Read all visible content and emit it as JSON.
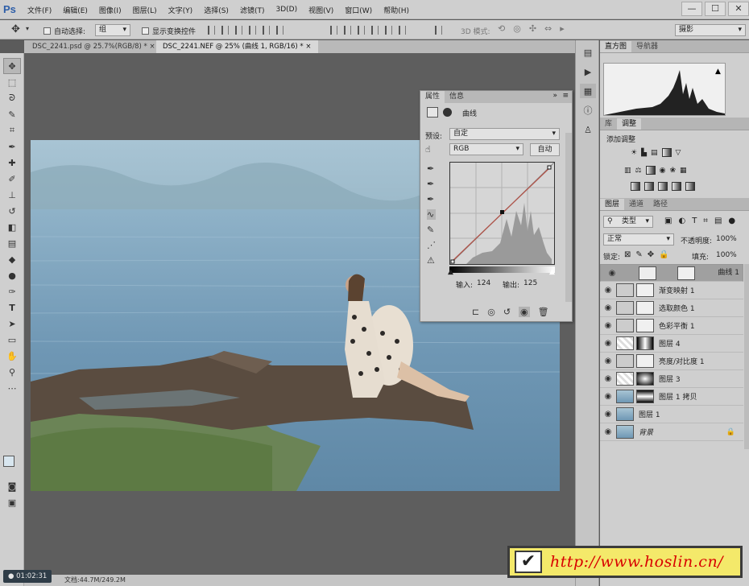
{
  "app": {
    "logo": "Ps"
  },
  "menu": [
    "文件(F)",
    "编辑(E)",
    "图像(I)",
    "图层(L)",
    "文字(Y)",
    "选择(S)",
    "滤镜(T)",
    "3D(D)",
    "视图(V)",
    "窗口(W)",
    "帮助(H)"
  ],
  "window_buttons": [
    "—",
    "☐",
    "✕"
  ],
  "options": {
    "auto_select_label": "自动选择:",
    "auto_select_value": "组",
    "show_transform_label": "显示变换控件",
    "mode3d_label": "3D 模式:",
    "workspace": "摄影"
  },
  "doc_tabs": [
    "DSC_2241.psd @ 25.7%(RGB/8) *",
    "DSC_2241.NEF @ 25% (曲线 1, RGB/16) *"
  ],
  "status": {
    "timer": "01:02:31",
    "doc_size": "文档:44.7M/249.2M"
  },
  "properties": {
    "tabs": [
      "属性",
      "信息"
    ],
    "title": "曲线",
    "preset_label": "预设:",
    "preset_value": "自定",
    "channel": "RGB",
    "auto_button": "自动",
    "input_label": "输入:",
    "input_value": "124",
    "output_label": "输出:",
    "output_value": "125"
  },
  "histogram_panel": {
    "tabs": [
      "直方图",
      "导航器"
    ]
  },
  "adjustments_panel": {
    "tabs": [
      "库",
      "调整"
    ],
    "add_label": "添加调整"
  },
  "layers_panel": {
    "tabs": [
      "图层",
      "通道",
      "路径"
    ],
    "filter_kind": "类型",
    "blend_mode": "正常",
    "opacity_label": "不透明度:",
    "opacity_value": "100%",
    "lock_label": "锁定:",
    "fill_label": "填充:",
    "fill_value": "100%",
    "layers": [
      {
        "name": "曲线 1",
        "selected": true
      },
      {
        "name": "渐变映射 1"
      },
      {
        "name": "选取颜色 1"
      },
      {
        "name": "色彩平衡 1"
      },
      {
        "name": "图层 4"
      },
      {
        "name": "亮度/对比度 1"
      },
      {
        "name": "图层 3"
      },
      {
        "name": "图层 1 拷贝"
      },
      {
        "name": "图层 1"
      },
      {
        "name": "背景"
      }
    ]
  },
  "watermark": {
    "url": "http://www.hoslin.cn/"
  },
  "colors": {
    "chrome": "#cfcfcf",
    "canvas": "#5e5e5e",
    "curve_line": "#b0544a",
    "watermark_bg": "#f4e96a",
    "watermark_text": "#d80000"
  }
}
